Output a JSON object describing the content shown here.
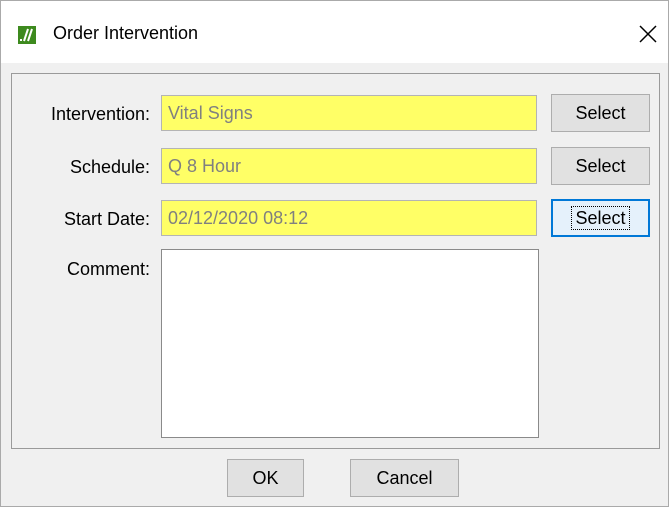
{
  "window": {
    "title": "Order Intervention",
    "icon": "app-icon",
    "close_glyph": "✕"
  },
  "form": {
    "intervention": {
      "label": "Intervention:",
      "value": "Vital Signs",
      "button": "Select"
    },
    "schedule": {
      "label": "Schedule:",
      "value": "Q 8 Hour",
      "button": "Select"
    },
    "start_date": {
      "label": "Start Date:",
      "value": "02/12/2020 08:12",
      "button": "Select"
    },
    "comment": {
      "label": "Comment:",
      "value": ""
    }
  },
  "footer": {
    "ok_label": "OK",
    "cancel_label": "Cancel"
  },
  "colors": {
    "required_field": "#ffff66",
    "focus_border": "#0078d7"
  }
}
